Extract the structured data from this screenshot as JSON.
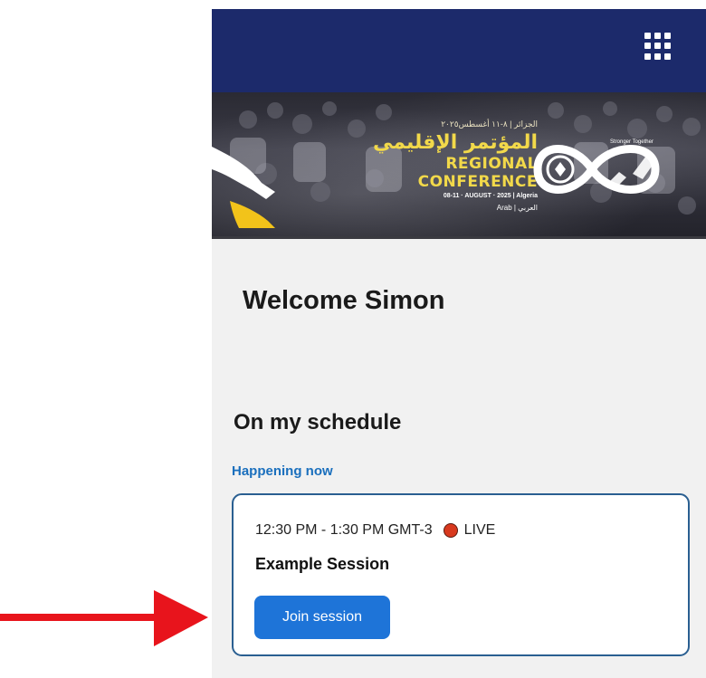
{
  "header": {
    "menu_icon": "grid-menu-icon",
    "colors": {
      "bar": "#1c2a6b",
      "icon": "#ffffff"
    }
  },
  "banner": {
    "arabic_subtitle": "الجزائر | ٨-١١ أغسطس٢٠٢٥",
    "arabic_title": "المؤتمر الإقليمي",
    "english_title": "REGIONAL CONFERENCE",
    "dates": "08-11 · AUGUST · 2025 | Algeria",
    "region": "Arab | العربي",
    "logo_caption": "Stronger Together",
    "colors": {
      "text": "#f2d94a"
    }
  },
  "main": {
    "welcome": "Welcome Simon",
    "schedule_heading": "On my schedule",
    "happening_label": "Happening now",
    "session": {
      "time": "12:30 PM - 1:30 PM GMT-3",
      "status": "LIVE",
      "title": "Example Session",
      "join_label": "Join session"
    },
    "colors": {
      "link": "#1a6fbd",
      "live": "#d8391e",
      "button": "#1e74d8",
      "card_border": "#2a5f91"
    }
  },
  "annotation": {
    "arrow_color": "#e8141c"
  }
}
